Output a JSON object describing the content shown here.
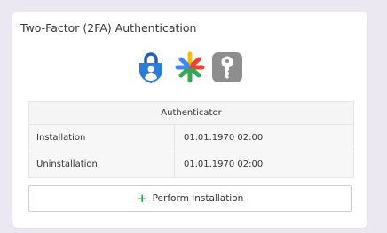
{
  "card": {
    "title": "Two-Factor (2FA) Authentication"
  },
  "icons": [
    "microsoft-authenticator-icon",
    "google-authenticator-icon",
    "key-authenticator-icon"
  ],
  "table": {
    "header": "Authenticator",
    "rows": [
      {
        "label": "Installation",
        "value": "01.01.1970 02:00"
      },
      {
        "label": "Uninstallation",
        "value": "01.01.1970 02:00"
      }
    ]
  },
  "action": {
    "label": "Perform Installation",
    "icon": "plus-icon"
  },
  "colors": {
    "background": "#ebe8f2",
    "card": "#ffffff",
    "plus": "#2e9e44",
    "ms_blue": "#2a7ed8",
    "key_gray": "#8e8e8e"
  }
}
